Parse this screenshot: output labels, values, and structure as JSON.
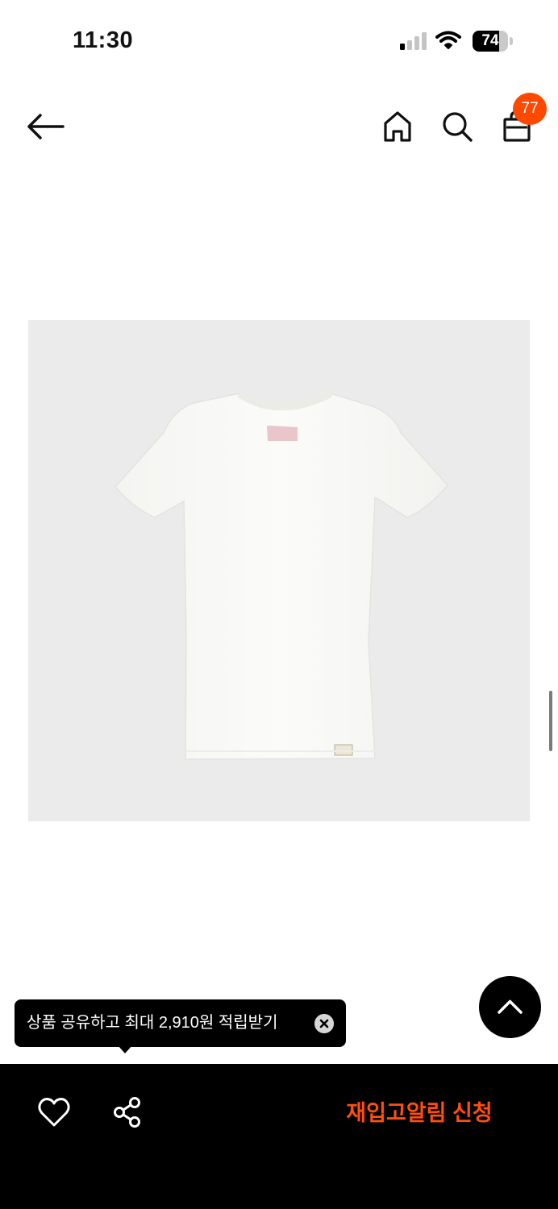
{
  "status_bar": {
    "time": "11:30",
    "battery_level": "74",
    "battery_fraction": 0.74,
    "signal_icon": "cellular-signal-icon",
    "wifi_icon": "wifi-icon"
  },
  "header": {
    "back_icon": "arrow-left-icon",
    "home_icon": "home-icon",
    "search_icon": "search-icon",
    "cart_icon": "shopping-bag-icon",
    "cart_count": "77"
  },
  "product": {
    "image_description_icon": "tshirt-product-photo"
  },
  "tooltip": {
    "text": "상품 공유하고 최대 2,910원 적립받기",
    "close_icon": "close-icon"
  },
  "scroll_top": {
    "icon": "chevron-up-icon"
  },
  "bottom_bar": {
    "like_icon": "heart-icon",
    "share_icon": "share-icon",
    "restock_label": "재입고알림 신청"
  },
  "colors": {
    "accent": "#ff4800",
    "cta_text": "#ff4e0d",
    "image_bg": "#ebebeb"
  }
}
